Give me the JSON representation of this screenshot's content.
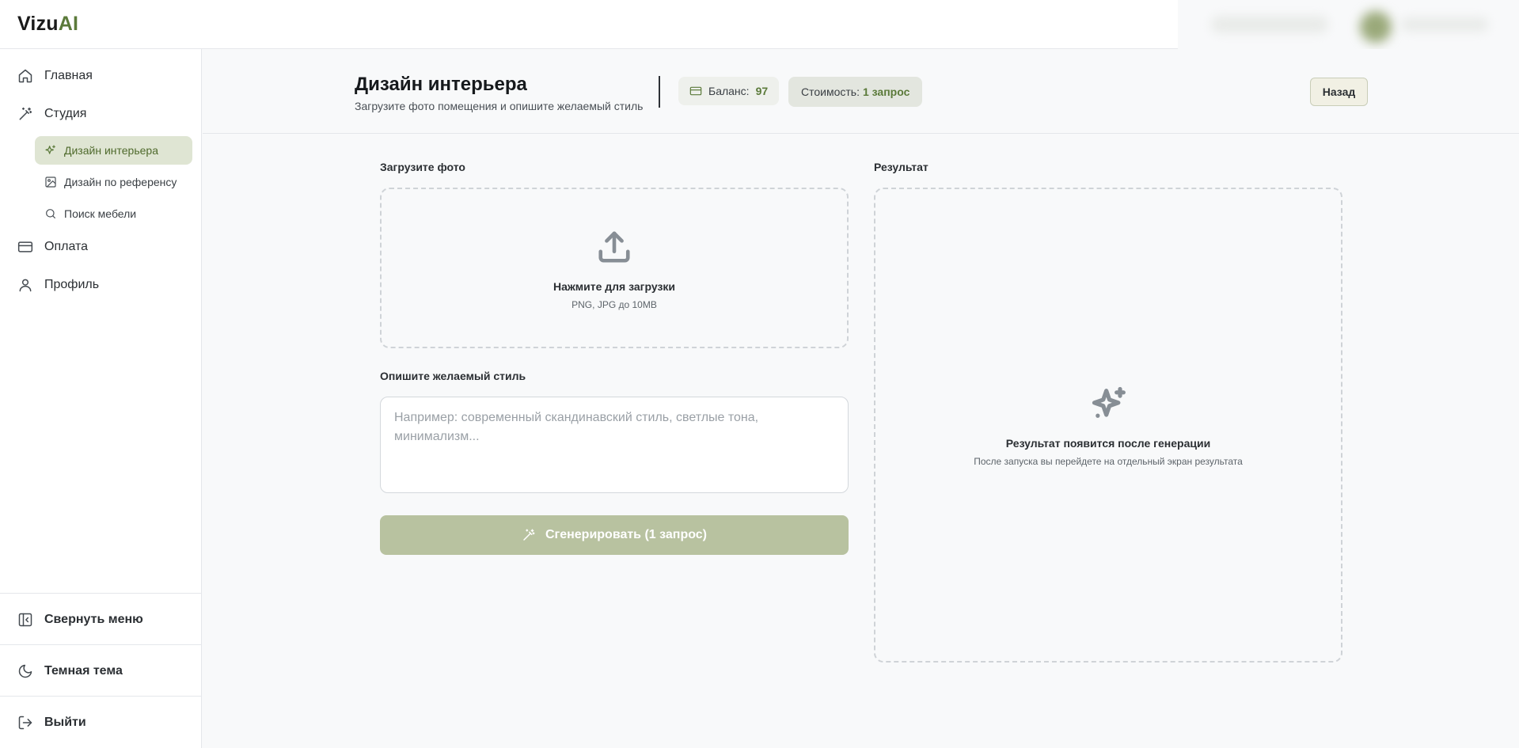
{
  "brand": {
    "name_part1": "Vizu",
    "name_part2": "AI",
    "accent_color": "#5b7a3a"
  },
  "sidebar": {
    "items": [
      {
        "label": "Главная",
        "icon": "home-icon"
      },
      {
        "label": "Студия",
        "icon": "magic-wand-icon"
      },
      {
        "label": "Оплата",
        "icon": "credit-card-icon"
      },
      {
        "label": "Профиль",
        "icon": "user-icon"
      }
    ],
    "studio_subitems": [
      {
        "label": "Дизайн интерьера",
        "icon": "sparkles-icon",
        "active": true
      },
      {
        "label": "Дизайн по референсу",
        "icon": "image-icon",
        "active": false
      },
      {
        "label": "Поиск мебели",
        "icon": "search-icon",
        "active": false
      }
    ],
    "bottom": {
      "collapse": "Свернуть меню",
      "theme": "Темная тема",
      "logout": "Выйти"
    }
  },
  "header": {
    "title": "Дизайн интерьера",
    "subtitle": "Загрузите фото помещения и опишите желаемый стиль",
    "balance_label": "Баланс:",
    "balance_value": "97",
    "cost_label": "Стоимость:",
    "cost_value": "1 запрос",
    "back_label": "Назад"
  },
  "upload": {
    "label": "Загрузите фото",
    "title": "Нажмите для загрузки",
    "hint": "PNG, JPG до 10MB"
  },
  "style": {
    "label": "Опишите желаемый стиль",
    "value": "",
    "placeholder": "Например: современный скандинавский стиль, светлые тона, минимализм..."
  },
  "generate": {
    "label": "Сгенерировать (1 запрос)"
  },
  "result": {
    "label": "Результат",
    "title": "Результат появится после генерации",
    "hint": "После запуска вы перейдете на отдельный экран результата"
  }
}
